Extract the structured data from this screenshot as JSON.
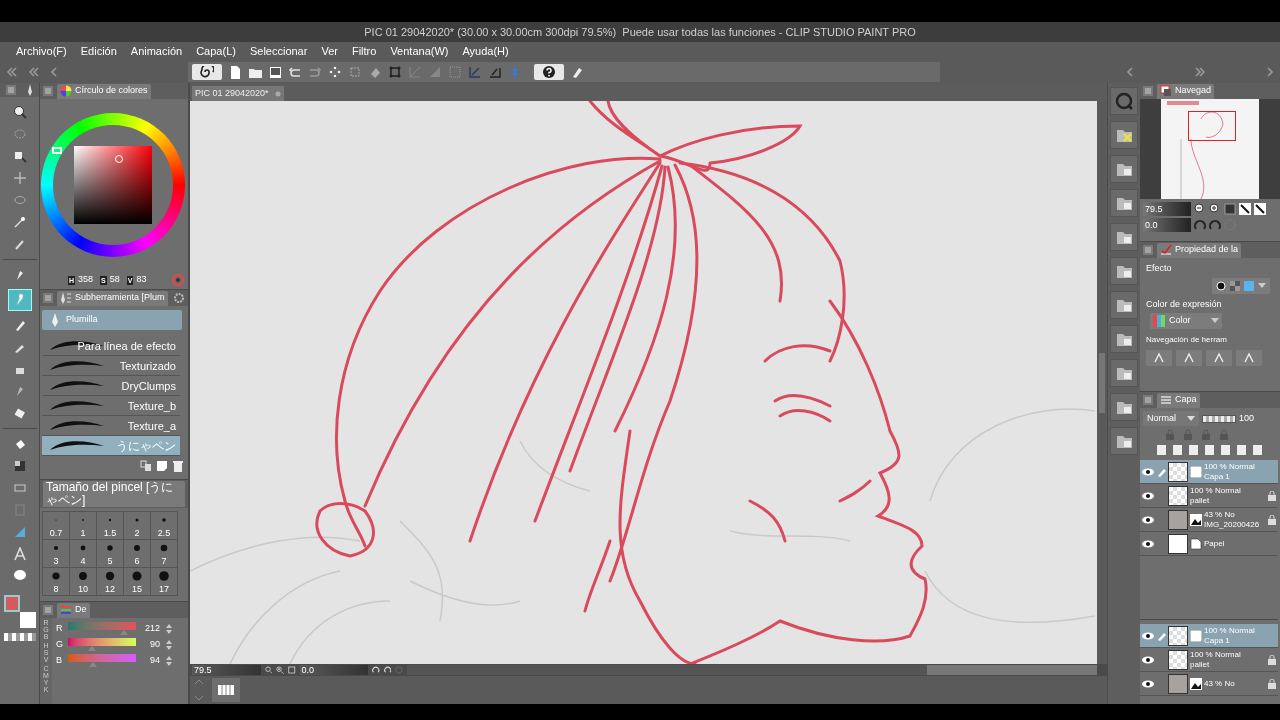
{
  "window": {
    "title": "PIC 01 29042020* (30.00 x 30.00cm 300dpi 79.5%)  Puede usar todas las funciones - CLIP STUDIO PAINT PRO"
  },
  "menu": [
    "Archivo(F)",
    "Edición",
    "Animación",
    "Capa(L)",
    "Seleccionar",
    "Ver",
    "Filtro",
    "Ventana(W)",
    "Ayuda(H)"
  ],
  "document_tab": {
    "label": "PIC 01 29042020*"
  },
  "tools": [
    {
      "selected": false
    },
    {
      "selected": false
    },
    {
      "selected": false
    },
    {
      "selected": false
    },
    {
      "selected": false
    },
    {
      "selected": false
    },
    {
      "selected": false
    },
    {
      "selected": false
    },
    {
      "selected": true
    },
    {
      "selected": false
    },
    {
      "selected": false
    },
    {
      "selected": false
    },
    {
      "selected": false
    },
    {
      "selected": false
    },
    {
      "selected": false
    },
    {
      "selected": false
    },
    {
      "selected": false
    },
    {
      "selected": false
    },
    {
      "selected": false
    },
    {
      "selected": false
    },
    {
      "selected": false
    }
  ],
  "color_wheel": {
    "title": "Círculo de colores",
    "h_label": "H",
    "h": "358",
    "s_label": "S",
    "s": "58",
    "v_label": "V",
    "v": "83"
  },
  "subtool": {
    "title": "Subherramienta [Plum",
    "group": "Plumilla",
    "brushes": [
      {
        "label": "Para línea de efecto",
        "selected": false
      },
      {
        "label": "Texturizado",
        "selected": false
      },
      {
        "label": "DryClumps",
        "selected": false
      },
      {
        "label": "Texture_b",
        "selected": false
      },
      {
        "label": "Texture_a",
        "selected": false
      },
      {
        "label": "うにゃペン",
        "selected": true
      }
    ]
  },
  "brush_size": {
    "title": "Tamaño del pincel [うにゃペン]",
    "sizes": [
      "0.7",
      "1",
      "1.5",
      "2",
      "2.5",
      "3",
      "4",
      "5",
      "6",
      "7",
      "8",
      "10",
      "12",
      "15",
      "17"
    ]
  },
  "color_slider": {
    "tab": "De",
    "modes": [
      "RGB",
      "HSV",
      "CMYK"
    ],
    "channels": [
      {
        "label": "R",
        "reading": "212",
        "level": 0.83
      },
      {
        "label": "G",
        "reading": "90",
        "level": 0.35
      },
      {
        "label": "B",
        "reading": "94",
        "level": 0.37
      }
    ]
  },
  "navigator": {
    "title": "Navegad",
    "zoom": "79.5",
    "angle": "0.0"
  },
  "properties": {
    "title": "Propiedad de la",
    "effect_label": "Efecto",
    "expression_label": "Color de expresión",
    "expression_value": "Color",
    "nav_label": "Navegación de herram"
  },
  "layers": {
    "title": "Capa",
    "blend": "Normal",
    "opacity": "100",
    "opacity_bar": {
      "level": 1
    },
    "items": [
      {
        "info": "100 % Normal",
        "name": "Capa 1",
        "selected": true,
        "editing": true,
        "locked": false,
        "kind": "raster"
      },
      {
        "info": "100 % Normal",
        "name": "pallet",
        "selected": false,
        "editing": false,
        "locked": true,
        "kind": "raster"
      },
      {
        "info": "43 % No",
        "name": "IMG_20200426",
        "selected": false,
        "editing": false,
        "locked": true,
        "kind": "image"
      },
      {
        "name": "Papel",
        "selected": false,
        "editing": false,
        "locked": false,
        "kind": "paper"
      }
    ]
  },
  "layers_lower": {
    "items": [
      {
        "info": "100 % Normal",
        "name": "Capa 1",
        "selected": true,
        "editing": true,
        "locked": false,
        "kind": "raster"
      },
      {
        "info": "100 % Normal",
        "name": "pallet",
        "selected": false,
        "editing": false,
        "locked": true,
        "kind": "raster"
      },
      {
        "info": "43 % No",
        "selected": false,
        "editing": false,
        "locked": true,
        "kind": "image"
      }
    ]
  },
  "status_bar": {
    "zoom": "79.5",
    "angle": "0.0"
  }
}
